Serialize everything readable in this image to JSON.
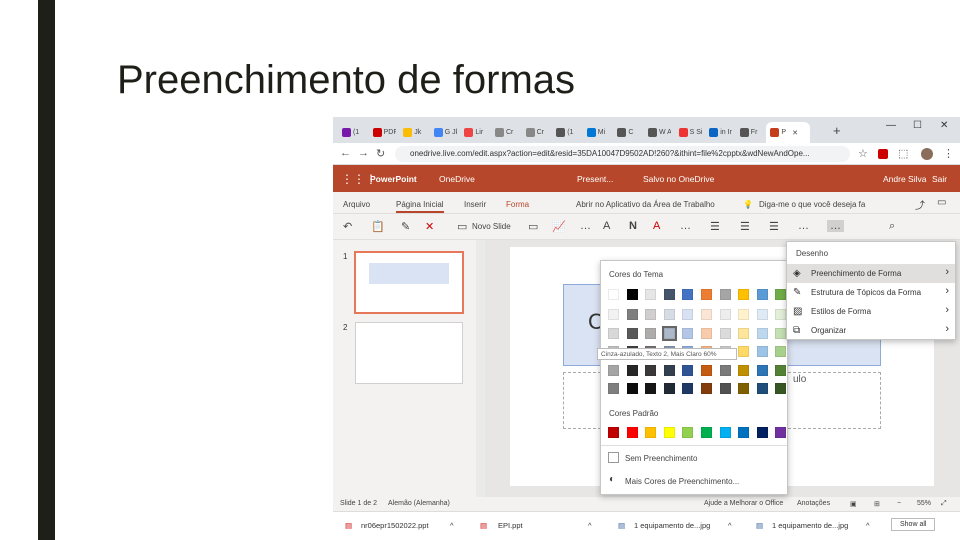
{
  "slide": {
    "title": "Preenchimento de formas"
  },
  "browser": {
    "tabs": [
      "(1",
      "PDF A",
      "Jk",
      "G Jk",
      "Lir",
      "Cr",
      "Cr",
      "(1",
      "Mi",
      "C",
      "W A",
      "S Si",
      "in Ir",
      "Fr",
      "P"
    ],
    "active_tab_close": "✕",
    "new_tab": "+",
    "url": "onedrive.live.com/edit.aspx?action=edit&resid=35DA10047D9502AD!260?&ithint=file%2cpptx&wdNewAndOpe..."
  },
  "ppt": {
    "app_name": "PowerPoint",
    "service": "OneDrive",
    "doc_title": "Present...",
    "saved_status": "Salvo no OneDrive",
    "user": "Andre Silva",
    "signout": "Sair"
  },
  "menubar": {
    "items": [
      "Arquivo",
      "Página Inicial",
      "Inserir",
      "Forma",
      "Abrir no Aplicativo da Área de Trabalho"
    ],
    "tell_me": "Diga-me o que você deseja fa"
  },
  "toolbar": {
    "new_slide": "Novo Slide"
  },
  "thumbs": {
    "n1": "1",
    "n2": "2"
  },
  "slide_content": {
    "box_letter": "C",
    "placeholder_suffix": "ulo"
  },
  "palette": {
    "theme_header": "Cores do Tema",
    "standard_header": "Cores Padrão",
    "no_fill": "Sem Preenchimento",
    "more_colors": "Mais Cores de Preenchimento...",
    "tooltip": "Cinza-azulado, Texto 2, Mais Claro 60%",
    "theme_colors": [
      [
        "#ffffff",
        "#000000",
        "#e7e6e6",
        "#44546a",
        "#4472c4",
        "#ed7d31",
        "#a5a5a5",
        "#ffc000",
        "#5b9bd5",
        "#70ad47"
      ],
      [
        "#f2f2f2",
        "#7f7f7f",
        "#d0cece",
        "#d6dce4",
        "#d9e2f3",
        "#fbe5d5",
        "#ededed",
        "#fff2cc",
        "#deeaf6",
        "#e2efd9"
      ],
      [
        "#d8d8d8",
        "#595959",
        "#aeabab",
        "#adb9ca",
        "#b4c6e7",
        "#f7cbac",
        "#dbdbdb",
        "#fee599",
        "#bdd7ee",
        "#c5e0b3"
      ],
      [
        "#bfbfbf",
        "#3f3f3f",
        "#757070",
        "#8496b0",
        "#8eaadb",
        "#f4b183",
        "#c9c9c9",
        "#ffd965",
        "#9dc3e6",
        "#a8d08d"
      ],
      [
        "#a5a5a5",
        "#262626",
        "#3a3838",
        "#323f4f",
        "#2f5496",
        "#c55a11",
        "#7b7b7b",
        "#bf8f00",
        "#2e75b5",
        "#538135"
      ],
      [
        "#7f7f7f",
        "#0c0c0c",
        "#171616",
        "#222a35",
        "#1f3864",
        "#833c0b",
        "#525252",
        "#7f6000",
        "#1e4e79",
        "#375623"
      ]
    ],
    "standard_colors": [
      "#c00000",
      "#ff0000",
      "#ffc000",
      "#ffff00",
      "#92d050",
      "#00b050",
      "#00b0f0",
      "#0070c0",
      "#002060",
      "#7030a0"
    ]
  },
  "shape_menu": {
    "header": "Desenho",
    "items": [
      {
        "label": "Preenchimento de Forma",
        "icon": "paint-bucket-icon"
      },
      {
        "label": "Estrutura de Tópicos da Forma",
        "icon": "pen-outline-icon"
      },
      {
        "label": "Estilos de Forma",
        "icon": "shape-styles-icon"
      },
      {
        "label": "Organizar",
        "icon": "arrange-icon"
      }
    ]
  },
  "status": {
    "slide_count": "Slide 1 de 2",
    "language": "Alemão (Alemanha)",
    "help": "Ajude a Melhorar o Office",
    "notes": "Anotações",
    "zoom": "55%"
  },
  "downloads": {
    "items": [
      "nr06epr1502022.ppt",
      "EPI.ppt",
      "1 equipamento de...jpg",
      "1 equipamento de...jpg"
    ],
    "show_all": "Show all"
  }
}
